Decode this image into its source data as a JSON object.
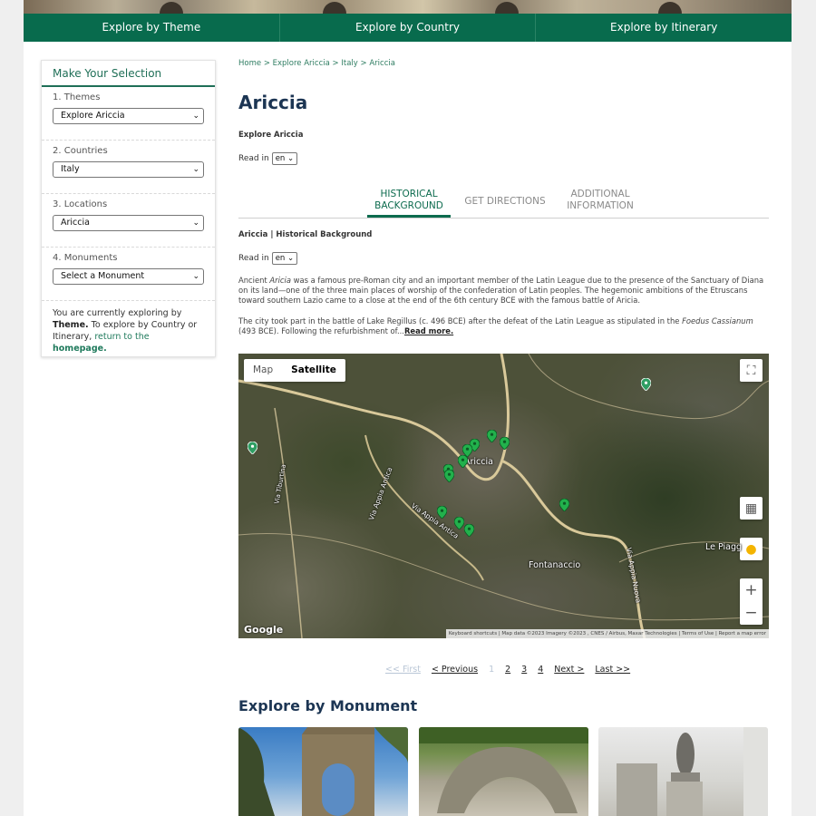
{
  "top_nav": [
    "Explore by Theme",
    "Explore by Country",
    "Explore by Itinerary"
  ],
  "sidebar": {
    "title": "Make Your Selection",
    "groups": [
      {
        "label": "1. Themes",
        "value": "Explore Ariccia"
      },
      {
        "label": "2. Countries",
        "value": "Italy"
      },
      {
        "label": "3. Locations",
        "value": "Ariccia"
      },
      {
        "label": "4. Monuments",
        "value": "Select a Monument"
      }
    ],
    "note": {
      "prefix": "You are currently exploring by",
      "theme": "Theme.",
      "middle": "To explore by Country or Itinerary,",
      "link": "return to the",
      "link_bold": "homepage."
    }
  },
  "breadcrumb": [
    "Home",
    "Explore Ariccia",
    "Italy",
    "Ariccia"
  ],
  "breadcrumb_sep": ">",
  "page_title": "Ariccia",
  "explore_label": "Explore Ariccia",
  "read_in_label": "Read in",
  "lang_value": "en",
  "tabs": [
    {
      "label_line1": "HISTORICAL",
      "label_line2": "BACKGROUND",
      "active": true
    },
    {
      "label_line1": "GET DIRECTIONS",
      "label_line2": "",
      "active": false
    },
    {
      "label_line1": "ADDITIONAL",
      "label_line2": "INFORMATION",
      "active": false
    }
  ],
  "section_label": "Ariccia | Historical Background",
  "paragraph1": {
    "before": "Ancient ",
    "italic": "Aricia",
    "after": " was a famous pre-Roman city and an important member of the Latin League due to the presence of the Sanctuary of Diana on its land—one of the three main places of worship of the confederation of Latin peoples. The hegemonic ambitions of the Etruscans toward southern Lazio came to a close at the end of the 6th century BCE with the famous battle of Aricia."
  },
  "paragraph2": {
    "before": "The city took part in the battle of Lake Regillus (c. 496 BCE) after the defeat of the Latin League as stipulated in the ",
    "italic": "Foedus Cassianum",
    "after": " (493 BCE). Following the refurbishment of...",
    "read_more": "Read more."
  },
  "map": {
    "type_map": "Map",
    "type_satellite": "Satellite",
    "labels": {
      "ariccia": "Ariccia",
      "fontanaccio": "Fontanaccio",
      "le_piagge": "Le Piagg",
      "via_appia_antica_1": "Via Appia Antica",
      "via_appia_antica_2": "Via Appia Antica",
      "via_appia_nuova": "Via Appia Nuova",
      "via_tiburtina": "Via Tiburtina"
    },
    "google": "Google",
    "attribution": "Keyboard shortcuts | Map data ©2023 Imagery ©2023 , CNES / Airbus, Maxar Technologies | Terms of Use | Report a map error",
    "zoom_in": "+",
    "zoom_out": "−"
  },
  "pagination": {
    "first": "<< First",
    "previous": "< Previous",
    "pages": [
      "1",
      "2",
      "3",
      "4"
    ],
    "next": "Next >",
    "last": "Last >>"
  },
  "explore_monument_title": "Explore by Monument",
  "colors": {
    "brand_green": "#086b4d",
    "title_navy": "#1c3553",
    "pin_green": "#22b14c"
  }
}
